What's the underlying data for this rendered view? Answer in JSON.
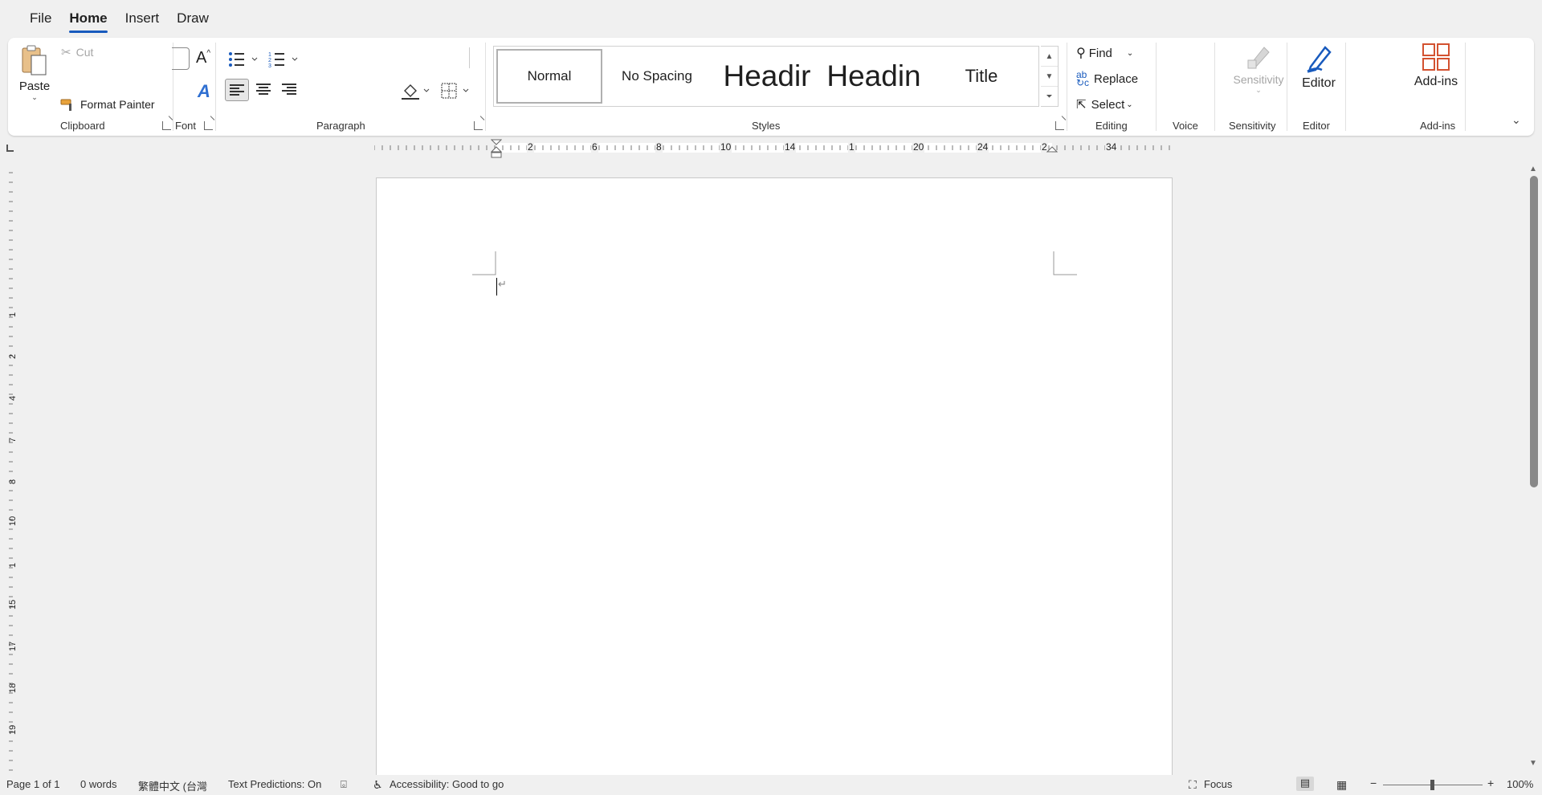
{
  "menu": {
    "tabs": [
      {
        "label": "File",
        "active": false
      },
      {
        "label": "Home",
        "active": true
      },
      {
        "label": "Insert",
        "active": false
      },
      {
        "label": "Draw",
        "active": false
      }
    ]
  },
  "ribbon": {
    "clipboard": {
      "paste_label": "Paste",
      "cut_label": "Cut",
      "format_painter_label": "Format Painter",
      "group_label": "Clipboard"
    },
    "font": {
      "group_label": "Font"
    },
    "paragraph": {
      "group_label": "Paragraph"
    },
    "styles": {
      "items": [
        "Normal",
        "No Spacing",
        "Headir",
        "Headin",
        "Title"
      ],
      "selected": "Normal",
      "group_label": "Styles"
    },
    "editing": {
      "find_label": "Find",
      "replace_label": "Replace",
      "select_label": "Select",
      "group_label": "Editing"
    },
    "voice": {
      "group_label": "Voice"
    },
    "sensitivity": {
      "button_label": "Sensitivity",
      "group_label": "Sensitivity"
    },
    "editor": {
      "button_label": "Editor",
      "group_label": "Editor"
    },
    "addins": {
      "button_label": "Add-ins",
      "group_label": "Add-ins"
    }
  },
  "ruler": {
    "horizontal_labels": [
      "2",
      "6",
      "8",
      "10",
      "14",
      "1",
      "20",
      "24",
      "2",
      "34"
    ],
    "vertical_labels": [
      "1",
      "2",
      "4",
      "7",
      "8",
      "10",
      "1",
      "15",
      "17",
      "18",
      "19"
    ]
  },
  "document": {
    "paragraph_mark": "↵"
  },
  "status": {
    "page": "Page 1 of 1",
    "words": "0 words",
    "language": "繁體中文 (台灣",
    "text_predictions": "Text Predictions: On",
    "accessibility": "Accessibility: Good to go",
    "focus": "Focus",
    "zoom": "100%"
  },
  "colors": {
    "accent": "#185abd",
    "addins_icon": "#d35230",
    "editor_icon": "#185abd"
  }
}
